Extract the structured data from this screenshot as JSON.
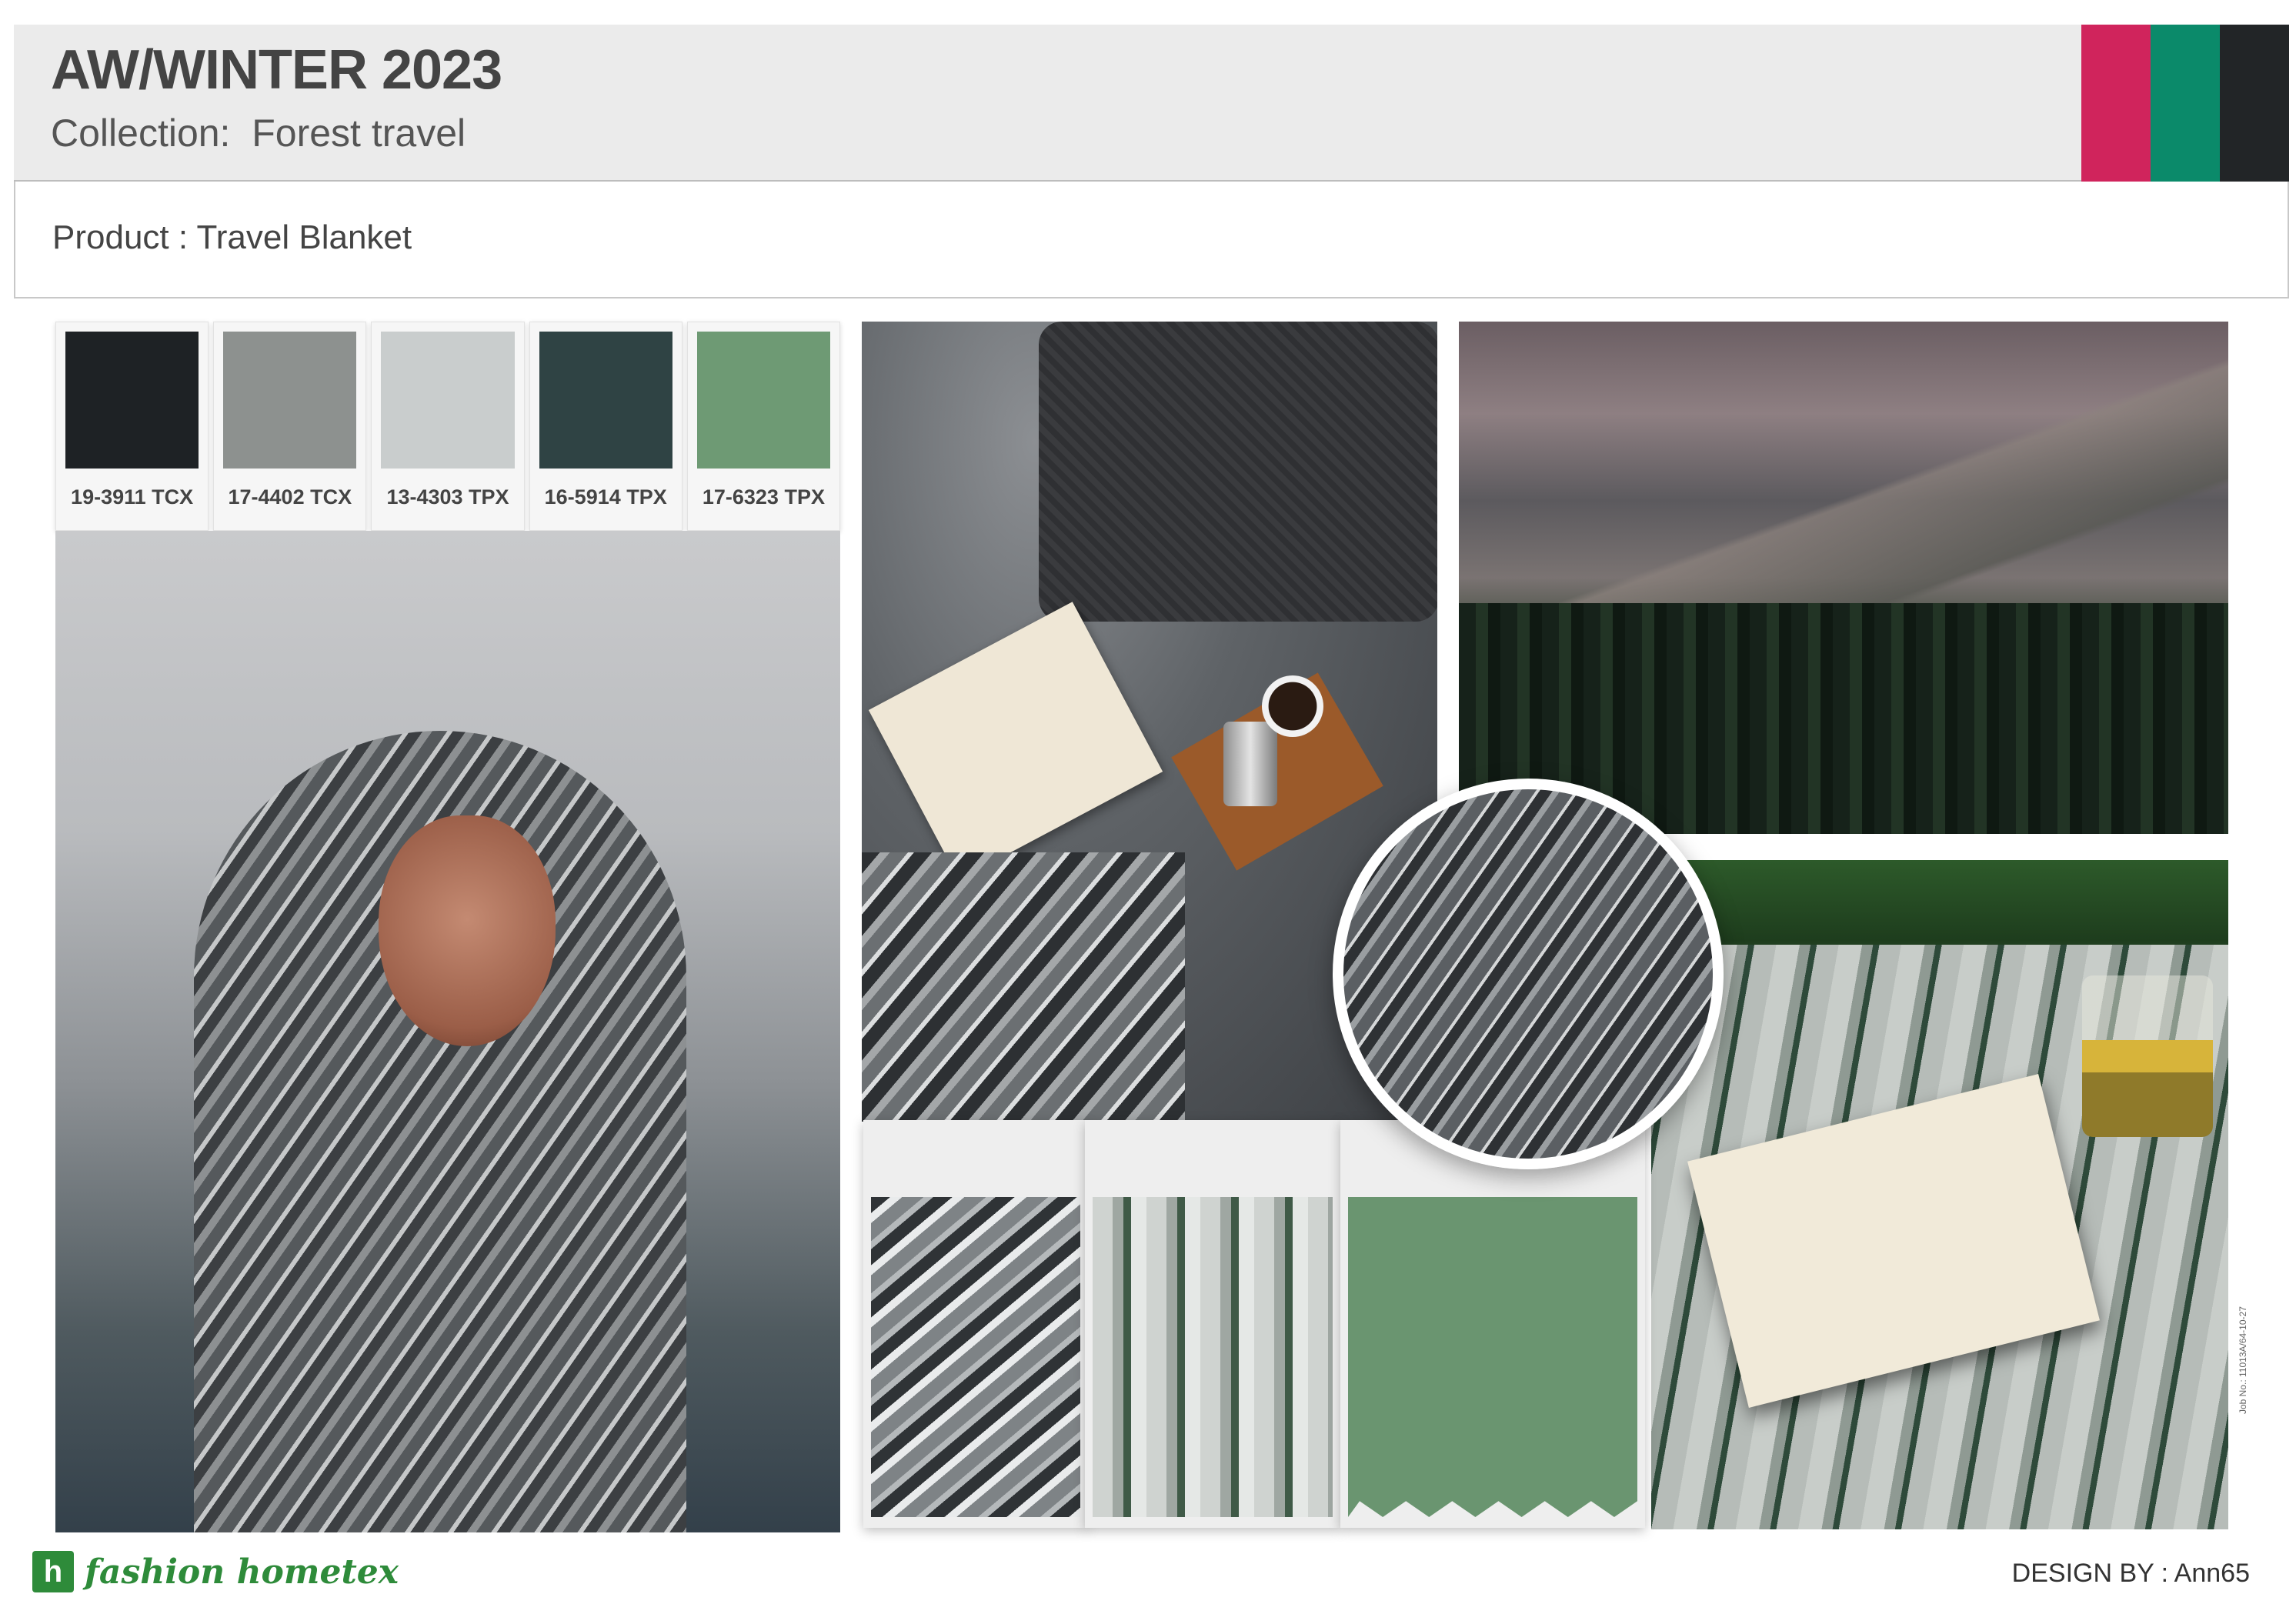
{
  "header": {
    "title": "AW/WINTER 2023",
    "collection_label": "Collection:",
    "collection_name": "Forest travel",
    "brand_colors": [
      "#d0245c",
      "#0b8a6a",
      "#222527"
    ]
  },
  "product": {
    "label": "Product :",
    "name": "Travel Blanket"
  },
  "swatches": [
    {
      "code": "19-3911 TCX",
      "color": "#1e2225"
    },
    {
      "code": "17-4402 TCX",
      "color": "#8d918f"
    },
    {
      "code": "13-4303 TPX",
      "color": "#c9cdcd"
    },
    {
      "code": "16-5914 TPX",
      "color": "#2f4344"
    },
    {
      "code": "17-6323 TPX",
      "color": "#6e9a74"
    }
  ],
  "images": {
    "woman": "woman-wrapped-in-mountain-print-blanket",
    "bed": "bed-with-book-coffee-and-blanket",
    "mountain": "misty-mountain-forest-landscape",
    "book": "open-book-on-tree-print-blanket",
    "circle": "mountain-print-fabric-closeup"
  },
  "fabric_cards": [
    {
      "pattern": "mountain-camo-print"
    },
    {
      "pattern": "pine-tree-print"
    },
    {
      "pattern": "solid-green",
      "color": "#6a9570"
    }
  ],
  "footer": {
    "logo_icon": "fh-logo-icon",
    "logo_text": "fashion hometex",
    "design_by": "DESIGN BY : Ann65",
    "job_no": "Job No.: 11013A/64-10-27"
  }
}
